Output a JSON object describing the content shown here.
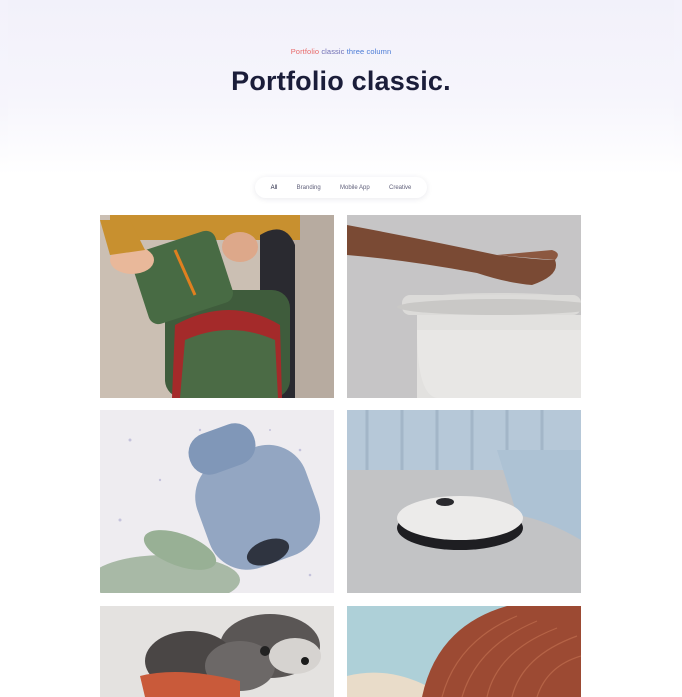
{
  "header": {
    "eyebrow_part1": "Portfolio",
    "eyebrow_part2": "classic",
    "eyebrow_part3": "three column",
    "title": "Portfolio classic."
  },
  "filters": [
    "All",
    "Branding",
    "Mobile App",
    "Creative"
  ],
  "portfolio": {
    "items": [
      {
        "name": "backpack"
      },
      {
        "name": "hand-bowl"
      },
      {
        "name": "speaker"
      },
      {
        "name": "robot-vacuum"
      },
      {
        "name": "dog"
      },
      {
        "name": "architecture"
      }
    ]
  }
}
